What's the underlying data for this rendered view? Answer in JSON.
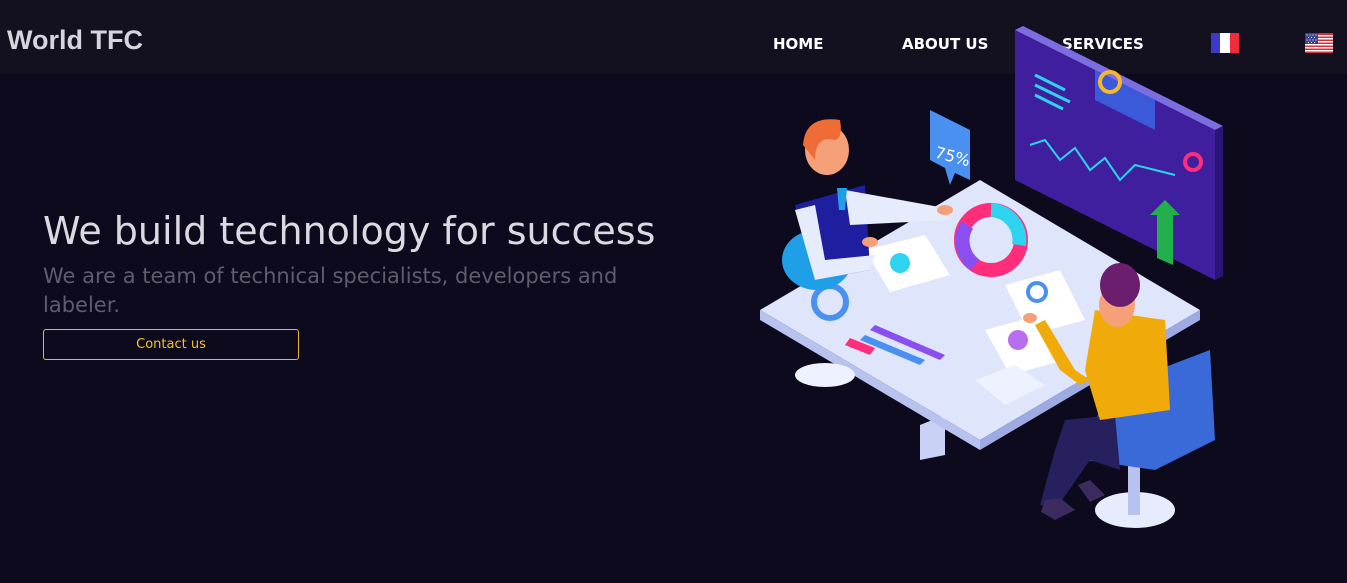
{
  "header": {
    "brand": "World TFC",
    "nav": [
      {
        "label": "HOME"
      },
      {
        "label": "ABOUT US"
      },
      {
        "label": "SERVICES"
      }
    ],
    "languages": [
      {
        "icon": "france-flag-icon"
      },
      {
        "icon": "usa-flag-icon"
      }
    ]
  },
  "hero": {
    "title": "We build technology for success",
    "subtitle": "We are a team of technical specialists, developers and labeler.",
    "cta_label": "Contact us"
  },
  "illustration": {
    "badge_text": "75%"
  },
  "colors": {
    "background": "#0d0a1d",
    "navbar": "#13101f",
    "accent": "#f2c12e",
    "title": "#dcdae0",
    "subtitle": "#5f5c6b"
  }
}
